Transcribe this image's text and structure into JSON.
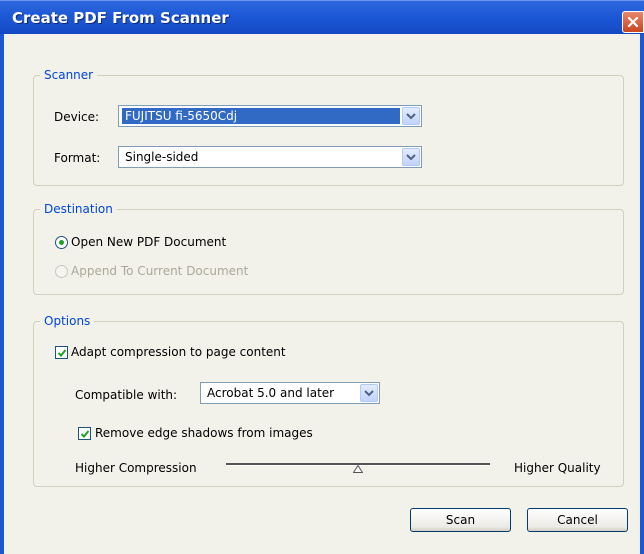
{
  "window": {
    "title": "Create PDF From Scanner"
  },
  "scanner": {
    "legend": "Scanner",
    "device_label": "Device:",
    "device_value": "FUJITSU fi-5650Cdj",
    "format_label": "Format:",
    "format_value": "Single-sided"
  },
  "destination": {
    "legend": "Destination",
    "option_new": "Open New PDF Document",
    "option_append": "Append To Current Document",
    "selected": "Open New PDF Document"
  },
  "options": {
    "legend": "Options",
    "adapt_label": "Adapt compression to page content",
    "adapt_checked": true,
    "compat_label": "Compatible with:",
    "compat_value": "Acrobat 5.0 and later",
    "edge_label": "Remove edge shadows from images",
    "edge_checked": true,
    "slider_left_label": "Higher Compression",
    "slider_right_label": "Higher Quality",
    "slider_level": 0.5
  },
  "buttons": {
    "scan": "Scan",
    "cancel": "Cancel"
  },
  "icons": {
    "close": "close-icon",
    "dropdown": "chevron-down-icon",
    "check": "checkmark-icon",
    "slider": "slider-thumb-icon"
  },
  "colors": {
    "titlebar": "#1c58d6",
    "group_legend": "#0046d5",
    "selection": "#316ac5",
    "dialog_bg": "#f2f1ea"
  }
}
